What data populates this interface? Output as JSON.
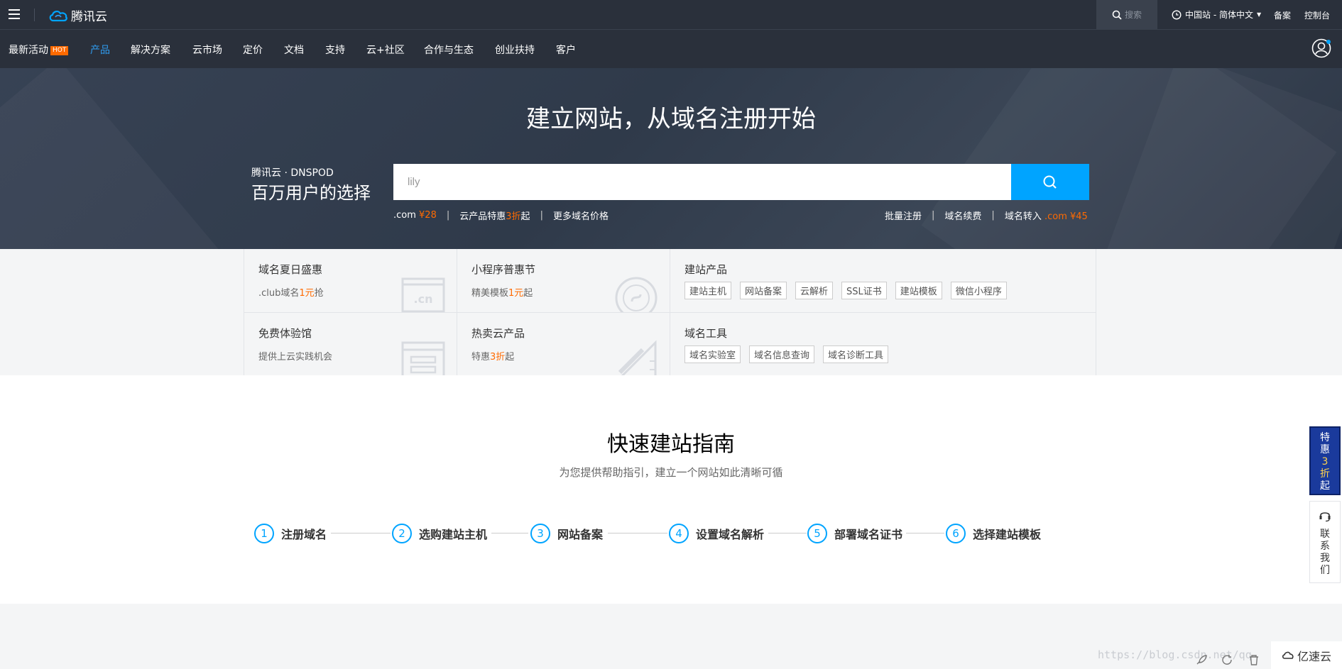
{
  "topbar": {
    "logo_text": "腾讯云",
    "search_placeholder": "搜索",
    "region_label": "中国站 - 简体中文",
    "links": [
      "备案",
      "控制台"
    ]
  },
  "nav": {
    "items": [
      {
        "label": "最新活动",
        "badge": "HOT"
      },
      {
        "label": "产品",
        "active": true
      },
      {
        "label": "解决方案"
      },
      {
        "label": "云市场"
      },
      {
        "label": "定价"
      },
      {
        "label": "文档"
      },
      {
        "label": "支持"
      },
      {
        "label": "云+社区"
      },
      {
        "label": "合作与生态"
      },
      {
        "label": "创业扶持"
      },
      {
        "label": "客户"
      }
    ]
  },
  "hero": {
    "title": "建立网站，从域名注册开始",
    "brand_small": "腾讯云 · DNSPOD",
    "brand_big": "百万用户的选择",
    "search_value": "lily",
    "left_links": {
      "com_label": ".com ",
      "com_price": "¥28",
      "sale_prefix": "云产品特惠",
      "sale_num": "3折",
      "sale_suffix": "起",
      "more": "更多域名价格"
    },
    "right_links": {
      "bulk": "批量注册",
      "renew": "域名续费",
      "transfer": "域名转入",
      "transfer_price": ".com ¥45"
    }
  },
  "promo": {
    "domain_sale": {
      "title": "域名夏日盛惠",
      "sub_prefix": ".club域名",
      "sub_num": "1元",
      "sub_suffix": "抢"
    },
    "mini_program": {
      "title": "小程序普惠节",
      "sub_prefix": "精美模板",
      "sub_num": "1元",
      "sub_suffix": "起"
    },
    "site_products": {
      "title": "建站产品",
      "tags": [
        "建站主机",
        "网站备案",
        "云解析",
        "SSL证书",
        "建站模板",
        "微信小程序"
      ]
    },
    "free_trial": {
      "title": "免费体验馆",
      "sub": "提供上云实践机会"
    },
    "hot_products": {
      "title": "热卖云产品",
      "sub_prefix": "特惠",
      "sub_num": "3折",
      "sub_suffix": "起"
    },
    "domain_tools": {
      "title": "域名工具",
      "tags": [
        "域名实验室",
        "域名信息查询",
        "域名诊断工具"
      ]
    }
  },
  "guide": {
    "title": "快速建站指南",
    "subtitle": "为您提供帮助指引，建立一个网站如此清晰可循",
    "steps": [
      {
        "num": "1",
        "label": "注册域名"
      },
      {
        "num": "2",
        "label": "选购建站主机"
      },
      {
        "num": "3",
        "label": "网站备案"
      },
      {
        "num": "4",
        "label": "设置域名解析"
      },
      {
        "num": "5",
        "label": "部署域名证书"
      },
      {
        "num": "6",
        "label": "选择建站模板"
      }
    ]
  },
  "floats": {
    "promo_a": "特惠",
    "promo_num": "3",
    "promo_b": "折",
    "promo_c": "起",
    "contact": "联系我们"
  },
  "watermark": "https://blog.csdn.net/qq",
  "yisu": "亿速云",
  "colors": {
    "accent": "#00a4ff",
    "orange": "#ff6a00",
    "dark": "#2a303b"
  }
}
